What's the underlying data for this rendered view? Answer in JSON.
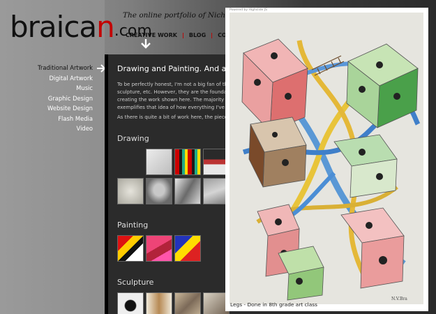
{
  "header": {
    "logo_prefix": "braica",
    "logo_n": "n",
    "logo_suffix": ".com",
    "tagline": "The online portfolio of Nicholas V. B"
  },
  "nav": {
    "items": [
      "CREATIVE WORK",
      "BLOG",
      "CONTACT"
    ],
    "separator": "|"
  },
  "sidebar": {
    "items": [
      {
        "label": "Traditional Artwork"
      },
      {
        "label": "Digital Artwork"
      },
      {
        "label": "Music"
      },
      {
        "label": "Graphic Design"
      },
      {
        "label": "Website Design"
      },
      {
        "label": "Flash Media"
      },
      {
        "label": "Video"
      }
    ]
  },
  "main": {
    "title": "Drawing and Painting. And all tha",
    "paragraph1": [
      "To be perfectly honest, I'm not a big fan of the me",
      "sculpture, etc. However, they are the foundation",
      "creating the work shown here. The majority of th",
      "exemplifies that idea of how everything I've done"
    ],
    "paragraph2": "As there is quite a bit of work here, the pieces ar",
    "sections": {
      "drawing": "Drawing",
      "painting": "Painting",
      "sculpture": "Sculpture"
    }
  },
  "lightbox": {
    "powered_by": "Powered by Highslide JS",
    "caption": "Legs - Done in 8th grade art class",
    "signature": "N.V.Bra"
  },
  "colors": {
    "accent": "#c30000",
    "panel": "#2b2b2b",
    "sidebar": "#9a9a9a"
  }
}
